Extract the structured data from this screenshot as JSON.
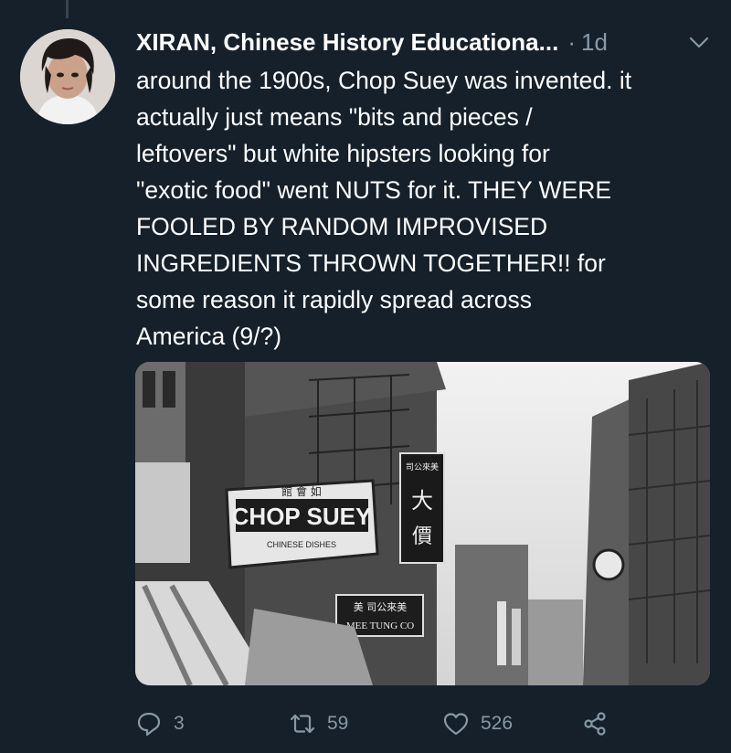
{
  "tweet": {
    "author_name": "XIRAN, Chinese History Educationa...",
    "separator": "·",
    "time": "1d",
    "text": "around the 1900s, Chop Suey was invented. it\nactually just means \"bits and pieces /\nleftovers\" but white hipsters looking for\n\"exotic food\" went NUTS for it. THEY WERE\nFOOLED BY RANDOM IMPROVISED\nINGREDIENTS THROWN TOGETHER!! for\nsome reason it rapidly spread across\nAmerica (9/?)"
  },
  "media": {
    "sign_main": "CHOP SUEY",
    "sign_sub": "CHINESE DISHES",
    "sign_top": "館 會 如",
    "sign_hanging": "司公來美",
    "sign_lower": "MEE TUNG CO",
    "sign_lower_cn": "美  司公來美"
  },
  "actions": {
    "reply_count": "3",
    "retweet_count": "59",
    "like_count": "526"
  },
  "icons": {
    "reply": "reply-icon",
    "retweet": "retweet-icon",
    "like": "heart-icon",
    "share": "share-icon",
    "caret": "chevron-down-icon"
  },
  "colors": {
    "background": "#15202b",
    "secondary_text": "#8899a6",
    "thread_line": "#38444d"
  }
}
